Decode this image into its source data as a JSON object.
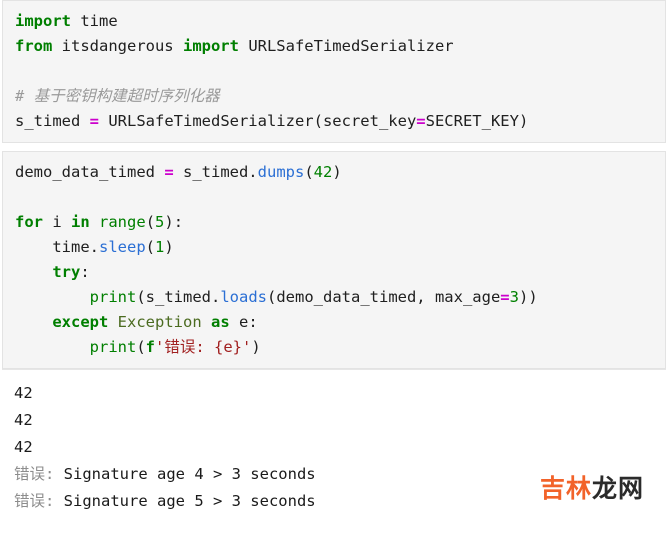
{
  "colors": {
    "cell_background": "#f5f5f5",
    "cell_border": "#e3e3e3",
    "output_background": "#ffffff",
    "keyword": "#007f00",
    "builtin": "#007f00",
    "number": "#008000",
    "operator": "#cc00cc",
    "method": "#2b6fd4",
    "identifier": "#202020",
    "class_name": "#4b6b20",
    "string": "#a11f1f",
    "comment": "#9a9a9a",
    "watermark_accent": "#f2632a",
    "watermark_dark": "#2b2b2b"
  },
  "cells": [
    {
      "type": "code",
      "lines": [
        {
          "id": "c1l1",
          "text": "import time"
        },
        {
          "id": "c1l2",
          "text": "from itsdangerous import URLSafeTimedSerializer"
        },
        {
          "id": "c1l3",
          "text": ""
        },
        {
          "id": "c1l4",
          "text": "# 基于密钥构建超时序列化器"
        },
        {
          "id": "c1l5",
          "text": "s_timed = URLSafeTimedSerializer(secret_key=SECRET_KEY)"
        }
      ]
    },
    {
      "type": "code",
      "lines": [
        {
          "id": "c2l1",
          "text": "demo_data_timed = s_timed.dumps(42)"
        },
        {
          "id": "c2l2",
          "text": ""
        },
        {
          "id": "c2l3",
          "text": "for i in range(5):"
        },
        {
          "id": "c2l4",
          "text": "    time.sleep(1)"
        },
        {
          "id": "c2l5",
          "text": "    try:"
        },
        {
          "id": "c2l6",
          "text": "        print(s_timed.loads(demo_data_timed, max_age=3))"
        },
        {
          "id": "c2l7",
          "text": "    except Exception as e:"
        },
        {
          "id": "c2l8",
          "text": "        print(f'错误: {e}')"
        }
      ]
    }
  ],
  "output": {
    "lines": [
      {
        "id": "o1",
        "prefix": "",
        "text": "42"
      },
      {
        "id": "o2",
        "prefix": "",
        "text": "42"
      },
      {
        "id": "o3",
        "prefix": "",
        "text": "42"
      },
      {
        "id": "o4",
        "prefix": "错误: ",
        "text": "Signature age 4 > 3 seconds"
      },
      {
        "id": "o5",
        "prefix": "错误: ",
        "text": "Signature age 5 > 3 seconds"
      }
    ]
  },
  "watermark": {
    "accent_text": "吉林",
    "dark_text": "龙网",
    "full_text": "吉林龙网"
  },
  "tokens": {
    "c1l1": [
      [
        "kw",
        "import"
      ],
      [
        "id",
        " time"
      ]
    ],
    "c1l2": [
      [
        "kw",
        "from"
      ],
      [
        "id",
        " itsdangerous "
      ],
      [
        "kw",
        "import"
      ],
      [
        "id",
        " URLSafeTimedSerializer"
      ]
    ],
    "c1l4": [
      [
        "cmt",
        "# 基于密钥构建超时序列化器"
      ]
    ],
    "c1l5": [
      [
        "id",
        "s_timed "
      ],
      [
        "op",
        "="
      ],
      [
        "id",
        " URLSafeTimedSerializer(secret_key"
      ],
      [
        "op",
        "="
      ],
      [
        "id",
        "SECRET_KEY)"
      ]
    ],
    "c2l1": [
      [
        "id",
        "demo_data_timed "
      ],
      [
        "op",
        "="
      ],
      [
        "id",
        " s_timed."
      ],
      [
        "fn",
        "dumps"
      ],
      [
        "id",
        "("
      ],
      [
        "num",
        "42"
      ],
      [
        "id",
        ")"
      ]
    ],
    "c2l3": [
      [
        "kw",
        "for"
      ],
      [
        "id",
        " i "
      ],
      [
        "kw",
        "in"
      ],
      [
        "id",
        " "
      ],
      [
        "bn",
        "range"
      ],
      [
        "id",
        "("
      ],
      [
        "num",
        "5"
      ],
      [
        "id",
        "):"
      ]
    ],
    "c2l4": [
      [
        "id",
        "    time."
      ],
      [
        "fn",
        "sleep"
      ],
      [
        "id",
        "("
      ],
      [
        "num",
        "1"
      ],
      [
        "id",
        ")"
      ]
    ],
    "c2l5": [
      [
        "id",
        "    "
      ],
      [
        "kw",
        "try"
      ],
      [
        "id",
        ":"
      ]
    ],
    "c2l6": [
      [
        "id",
        "        "
      ],
      [
        "bn",
        "print"
      ],
      [
        "id",
        "(s_timed."
      ],
      [
        "fn",
        "loads"
      ],
      [
        "id",
        "(demo_data_timed, max_age"
      ],
      [
        "op",
        "="
      ],
      [
        "num",
        "3"
      ],
      [
        "id",
        "))"
      ]
    ],
    "c2l7": [
      [
        "id",
        "    "
      ],
      [
        "kw",
        "except"
      ],
      [
        "id",
        " "
      ],
      [
        "cls",
        "Exception"
      ],
      [
        "id",
        " "
      ],
      [
        "kw",
        "as"
      ],
      [
        "id",
        " e:"
      ]
    ],
    "c2l8": [
      [
        "id",
        "        "
      ],
      [
        "bn",
        "print"
      ],
      [
        "id",
        "("
      ],
      [
        "pfx",
        "f"
      ],
      [
        "str",
        "'错误: {e}'"
      ],
      [
        "id",
        ")"
      ]
    ]
  }
}
